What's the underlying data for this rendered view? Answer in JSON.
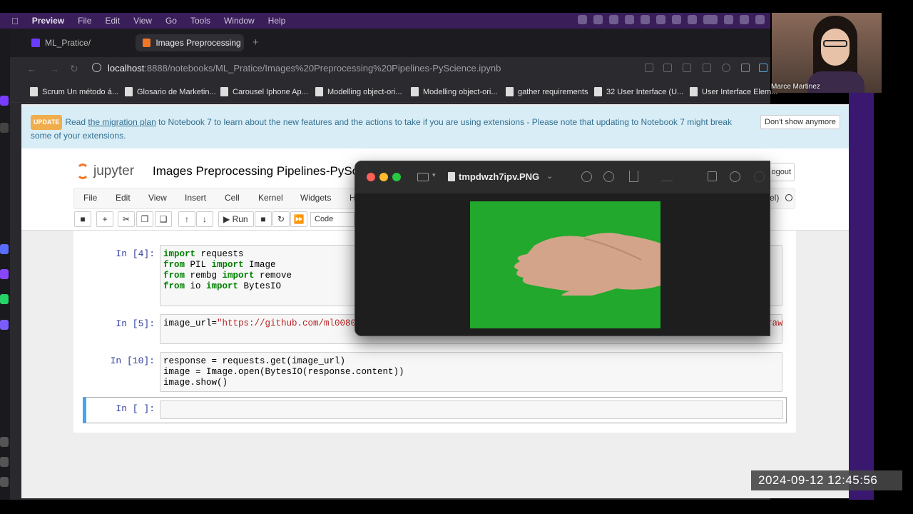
{
  "menubar": {
    "app_name": "Preview",
    "items": [
      "File",
      "Edit",
      "View",
      "Go",
      "Tools",
      "Window",
      "Help"
    ]
  },
  "browser": {
    "tabs": [
      {
        "label": "ML_Pratice/"
      },
      {
        "label": "Images Preprocessing P"
      }
    ],
    "url_host": "localhost",
    "url_path": ":8888/notebooks/ML_Pratice/Images%20Preprocessing%20Pipelines-PyScience.ipynb",
    "bookmarks": [
      "Scrum Un método á...",
      "Glosario de Marketin...",
      "Carousel Iphone Ap...",
      "Modelling object-ori...",
      "Modelling object-ori...",
      "gather requirements",
      "32 User Interface (U...",
      "User Interface Elem..."
    ]
  },
  "banner": {
    "badge": "UPDATE",
    "text_before": "Read",
    "link": "the migration plan",
    "text_after": "to Notebook 7 to learn about the new features and the actions to take if you are using extensions - Please note that updating to Notebook 7 might break some of your extensions.",
    "dismiss_label": "Don't show anymore"
  },
  "jupyter": {
    "logo_text": "jupyter",
    "notebook_title": "Images Preprocessing Pipelines-PySc",
    "logout_label": "ogout",
    "menu": [
      "File",
      "Edit",
      "View",
      "Insert",
      "Cell",
      "Kernel",
      "Widgets",
      "H"
    ],
    "kernel_fragment": "el)",
    "run_label": "Run",
    "cell_type": "Code"
  },
  "cells": [
    {
      "prompt": "In [4]:"
    },
    {
      "prompt": "In [5]:",
      "code_prefix": "image_url=",
      "code_string": "\"https://github.com/ml0080",
      "code_tail": "raw"
    },
    {
      "prompt": "In [10]:",
      "lines": [
        "response = requests.get(image_url)",
        "image = Image.open(BytesIO(response.content))",
        "image.show()"
      ]
    },
    {
      "prompt": "In [ ]:"
    }
  ],
  "cell4": {
    "l1_kw": "import",
    "l1_rest": " requests",
    "l2_kw1": "from",
    "l2_mid": " PIL ",
    "l2_kw2": "import",
    "l2_rest": " Image",
    "l3_kw1": "from",
    "l3_mid": " rembg ",
    "l3_kw2": "import",
    "l3_rest": " remove",
    "l4_kw1": "from",
    "l4_mid": " io ",
    "l4_kw2": "import",
    "l4_rest": " BytesIO"
  },
  "preview_window": {
    "filename": "tmpdwzh7ipv.PNG"
  },
  "webcam": {
    "name": "Marce Martinez"
  },
  "timestamp": "2024-09-12  12:45:56",
  "colors": {
    "menubar_bg": "#3a1e5a",
    "jupyter_orange": "#f37726",
    "prompt_blue": "#303f9f",
    "keyword_green": "#008000",
    "string_red": "#ba2121",
    "green_screen": "#22a82c"
  }
}
